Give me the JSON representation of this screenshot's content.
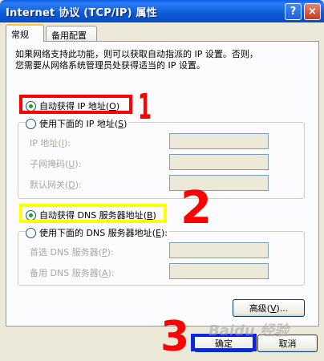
{
  "window": {
    "title": "Internet 协议 (TCP/IP) 属性",
    "help_glyph": "?",
    "close_glyph": "×"
  },
  "tabs": [
    {
      "label": "常规",
      "active": true
    },
    {
      "label": "备用配置",
      "active": false
    }
  ],
  "intro": {
    "line1": "如果网络支持此功能，则可以获取自动指派的 IP 设置。否则，",
    "line2": "您需要从网络系统管理员处获得适当的 IP 设置。"
  },
  "ip": {
    "auto_radio": {
      "text": "自动获得 IP 地址",
      "key": "O",
      "selected": true
    },
    "manual_radio": {
      "text": "使用下面的 IP 地址",
      "key": "S",
      "selected": false
    },
    "fields": [
      {
        "label": "IP 地址",
        "key": "I",
        "value": ""
      },
      {
        "label": "子网掩码",
        "key": "U",
        "value": ""
      },
      {
        "label": "默认网关",
        "key": "D",
        "value": ""
      }
    ]
  },
  "dns": {
    "auto_radio": {
      "text": "自动获得 DNS 服务器地址",
      "key": "B",
      "selected": true
    },
    "manual_radio": {
      "text": "使用下面的 DNS 服务器地址",
      "key": "E",
      "selected": false
    },
    "fields": [
      {
        "label": "首选 DNS 服务器",
        "key": "P",
        "value": ""
      },
      {
        "label": "备用 DNS 服务器",
        "key": "A",
        "value": ""
      }
    ]
  },
  "buttons": {
    "advanced": {
      "text": "高级",
      "key": "V",
      "suffix": "..."
    },
    "ok": "确定",
    "cancel": "取消"
  },
  "annotations": {
    "step1": "1",
    "step2": "2",
    "step3": "3",
    "colors": {
      "red": "#FF0000",
      "yellow": "#FFFF00",
      "blue": "#1024E6"
    }
  },
  "watermark": "Baidu 经验"
}
